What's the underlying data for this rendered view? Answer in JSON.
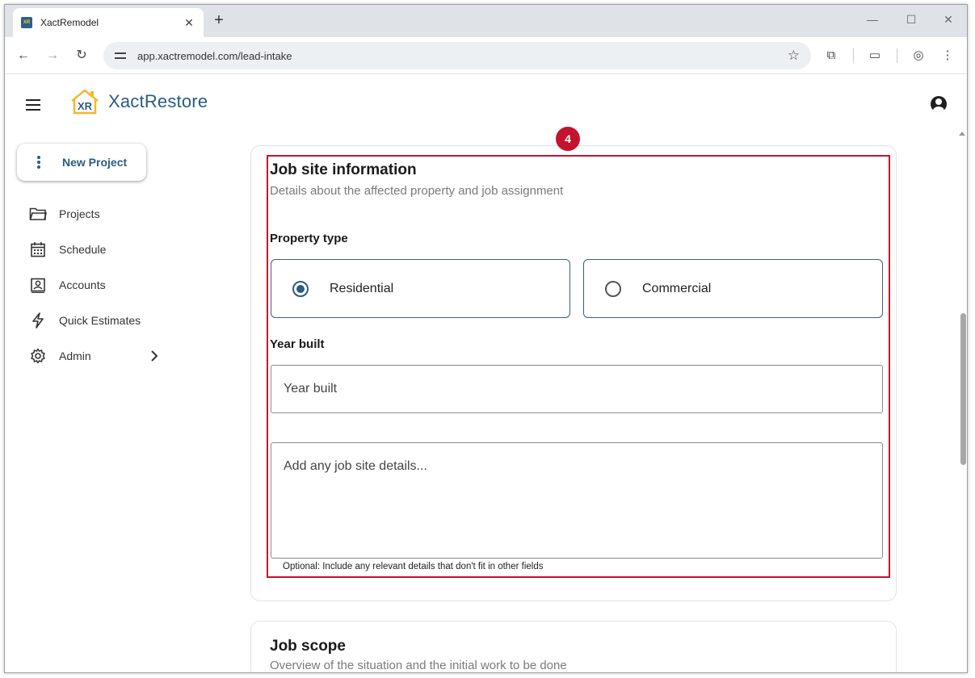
{
  "browser": {
    "tab_title": "XactRemodel",
    "tab_close": "✕",
    "new_tab": "+",
    "url": "app.xactremodel.com/lead-intake",
    "controls": {
      "minimize": "—",
      "maximize": "☐",
      "close": "✕"
    }
  },
  "app": {
    "brand": "XactRestore",
    "logo_letters": "XR",
    "accent_color": "#2b5c80",
    "highlight_color": "#c4122f"
  },
  "sidebar": {
    "new_project_label": "New Project",
    "items": [
      {
        "label": "Projects",
        "icon": "folder-icon"
      },
      {
        "label": "Schedule",
        "icon": "calendar-icon"
      },
      {
        "label": "Accounts",
        "icon": "contact-card-icon"
      },
      {
        "label": "Quick Estimates",
        "icon": "lightning-icon"
      },
      {
        "label": "Admin",
        "icon": "gear-icon"
      }
    ]
  },
  "job_site": {
    "step_number": "4",
    "title": "Job site information",
    "subtitle": "Details about the affected property and job assignment",
    "property_type_label": "Property type",
    "property_options": [
      {
        "label": "Residential",
        "selected": true
      },
      {
        "label": "Commercial",
        "selected": false
      }
    ],
    "year_built_label": "Year built",
    "year_built_placeholder": "Year built",
    "year_built_value": "",
    "details_placeholder": "Add any job site details...",
    "details_value": "",
    "details_hint": "Optional: Include any relevant details that don't fit in other fields"
  },
  "job_scope": {
    "title": "Job scope",
    "subtitle": "Overview of the situation and the initial work to be done"
  }
}
